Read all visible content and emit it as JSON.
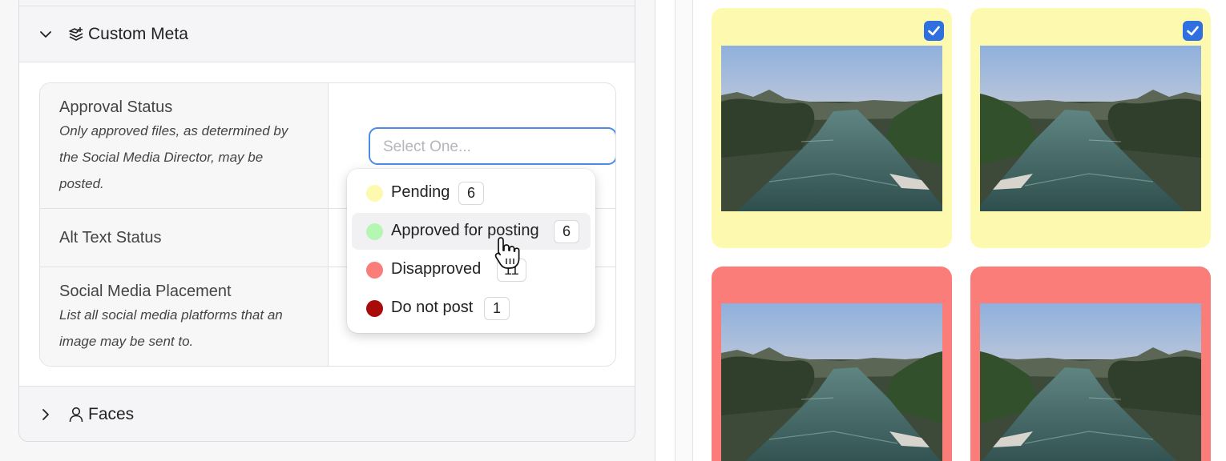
{
  "accordion": {
    "custom_meta": {
      "title": "Custom Meta",
      "icon": "stack-plus-icon",
      "expanded": true
    },
    "faces": {
      "title": "Faces",
      "icon": "person-icon",
      "expanded": false
    }
  },
  "meta_fields": [
    {
      "label": "Approval Status",
      "description": "Only approved files, as determined by the Social Media Director, may be posted."
    },
    {
      "label": "Alt Text Status",
      "description": ""
    },
    {
      "label": "Social Media Placement",
      "description": "List all social media platforms that an image may be sent to."
    }
  ],
  "approval_select": {
    "placeholder": "Select One...",
    "options": [
      {
        "label": "Pending",
        "count": "6",
        "color": "#fdfab0"
      },
      {
        "label": "Approved for posting",
        "count": "6",
        "color": "#b5f7b2"
      },
      {
        "label": "Disapproved",
        "count": "11",
        "color": "#fb7d7a"
      },
      {
        "label": "Do not post",
        "count": "1",
        "color": "#a90a0a"
      }
    ],
    "hovered_option": "Approved for posting"
  },
  "gallery": [
    {
      "status": "Pending",
      "background": "#fdfab0",
      "selected": true
    },
    {
      "status": "Pending",
      "background": "#fdfab0",
      "selected": true
    },
    {
      "status": "Disapproved",
      "background": "#fb7d7a",
      "selected": false
    },
    {
      "status": "Disapproved",
      "background": "#fb7d7a",
      "selected": false
    }
  ],
  "colors": {
    "accent": "#4c8ce6",
    "checkbox": "#2f6fe0"
  }
}
